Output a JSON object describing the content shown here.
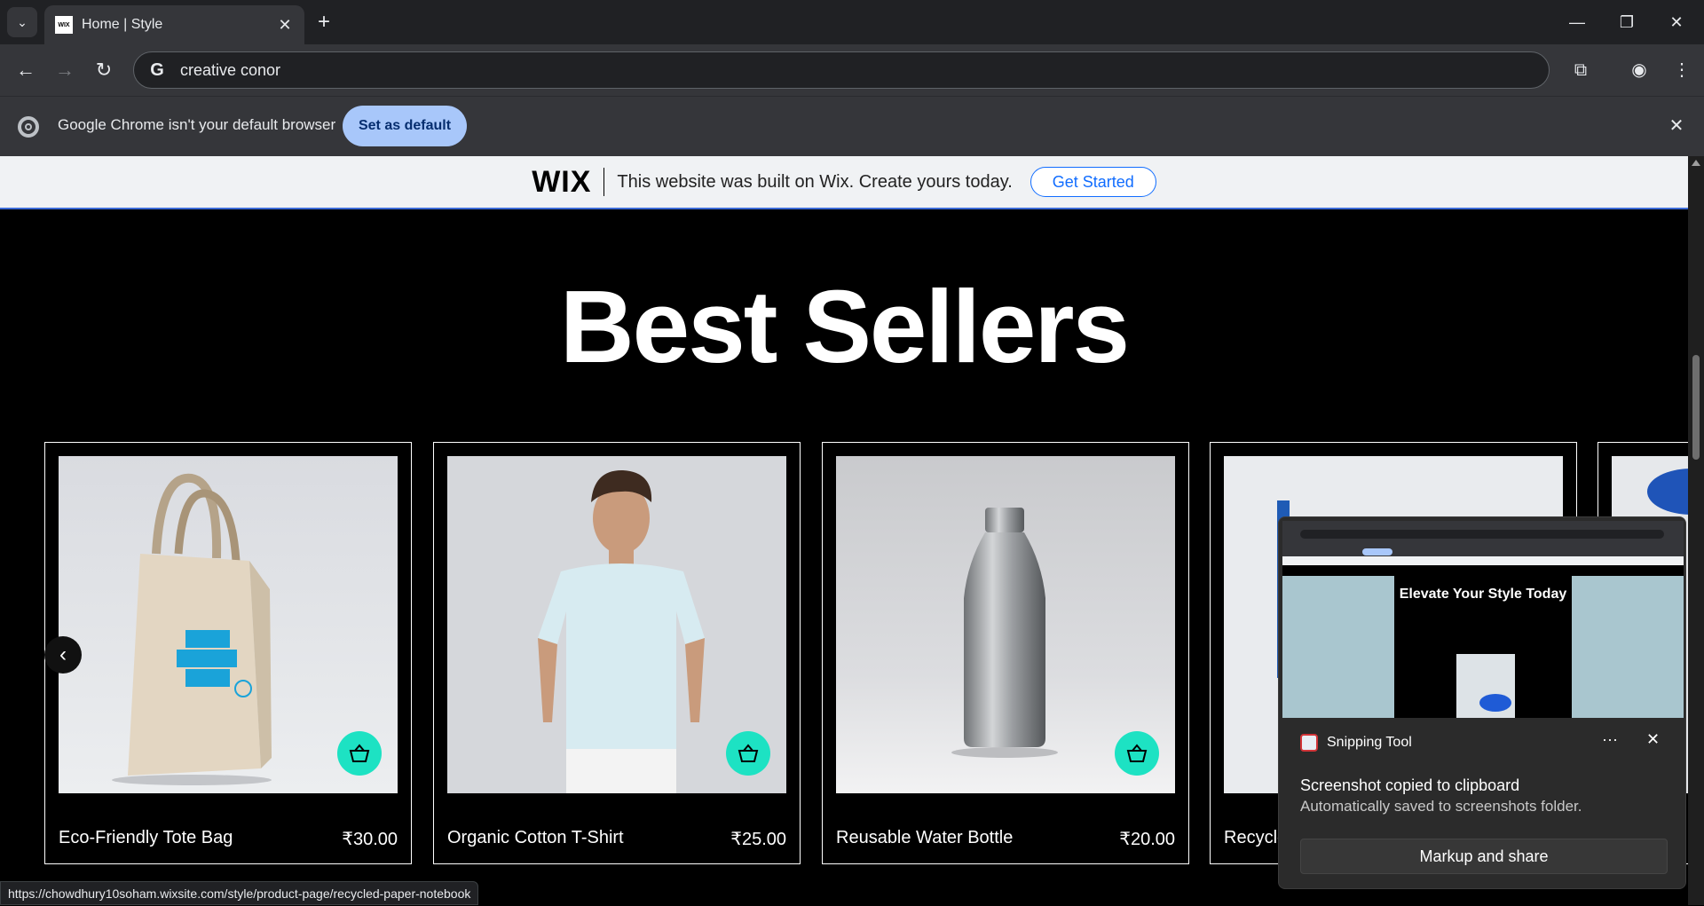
{
  "browser": {
    "tab_title": "Home | Style",
    "tab_favicon": "WIX",
    "address": "creative conor",
    "infobar_text": "Google Chrome isn't your default browser",
    "infobar_button": "Set as default",
    "status_url": "https://chowdhury10soham.wixsite.com/style/product-page/recycled-paper-notebook"
  },
  "wix_banner": {
    "logo": "WIX",
    "text": "This website was built on Wix. Create yours today.",
    "button": "Get Started",
    "accent": "#116dff"
  },
  "section": {
    "heading": "Best Sellers"
  },
  "products": [
    {
      "name": "Eco-Friendly Tote Bag",
      "price": "₹30.00"
    },
    {
      "name": "Organic Cotton T-Shirt",
      "price": "₹25.00"
    },
    {
      "name": "Reusable Water Bottle",
      "price": "₹20.00"
    },
    {
      "name": "Recycle",
      "price": ""
    }
  ],
  "cart_color": "#1de2c3",
  "snipping_tool": {
    "app_name": "Snipping Tool",
    "title": "Screenshot copied to clipboard",
    "subtitle": "Automatically saved to screenshots folder.",
    "button": "Markup and share",
    "preview_heading": "Elevate Your Style Today"
  }
}
